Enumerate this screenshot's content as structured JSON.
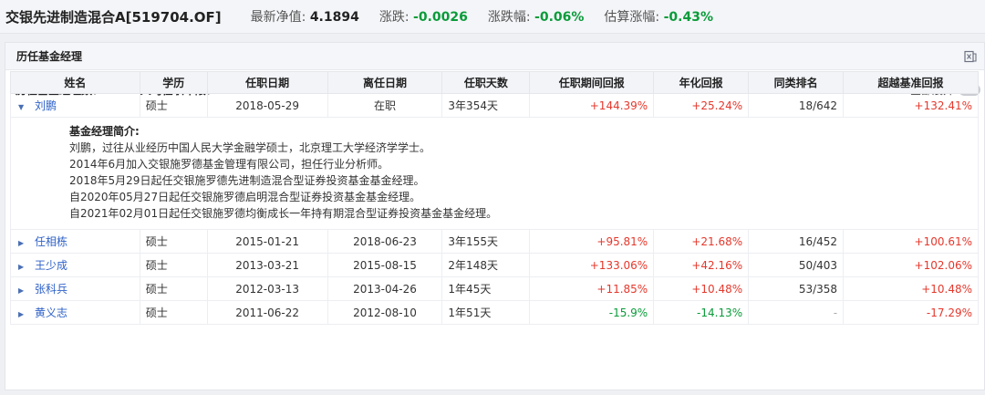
{
  "header": {
    "fund_name": "交银先进制造混合A[519704.OF]",
    "nav_label": "最新净值: ",
    "nav_value": "4.1894",
    "change_label": "涨跌: ",
    "change_value": "-0.0026",
    "change_pct_label": "涨跌幅: ",
    "change_pct_value": "-0.06%",
    "est_label": "估算涨幅: ",
    "est_value": "-0.43%"
  },
  "panel": {
    "title": "历任基金经理",
    "export_icon": "export-excel-icon",
    "count_label": "历任基金经理数：",
    "count_value": "5",
    "avg_label": "人均任职年限：",
    "avg_value": "2.41",
    "expand_all_label": "全部展开"
  },
  "table": {
    "columns": [
      "姓名",
      "学历",
      "任职日期",
      "离任日期",
      "任职天数",
      "任职期间回报",
      "年化回报",
      "同类排名",
      "超越基准回报"
    ],
    "rows": [
      {
        "name": "刘鹏",
        "edu": "硕士",
        "start": "2018-05-29",
        "end": "在职",
        "days": "3年354天",
        "ret": "+144.39%",
        "ann": "+25.24%",
        "rank": "18/642",
        "excess": "+132.41%"
      },
      {
        "name": "任相栋",
        "edu": "硕士",
        "start": "2015-01-21",
        "end": "2018-06-23",
        "days": "3年155天",
        "ret": "+95.81%",
        "ann": "+21.68%",
        "rank": "16/452",
        "excess": "+100.61%"
      },
      {
        "name": "王少成",
        "edu": "硕士",
        "start": "2013-03-21",
        "end": "2015-08-15",
        "days": "2年148天",
        "ret": "+133.06%",
        "ann": "+42.16%",
        "rank": "50/403",
        "excess": "+102.06%"
      },
      {
        "name": "张科兵",
        "edu": "硕士",
        "start": "2012-03-13",
        "end": "2013-04-26",
        "days": "1年45天",
        "ret": "+11.85%",
        "ann": "+10.48%",
        "rank": "53/358",
        "excess": "+10.48%"
      },
      {
        "name": "黄义志",
        "edu": "硕士",
        "start": "2011-06-22",
        "end": "2012-08-10",
        "days": "1年51天",
        "ret": "-15.9%",
        "ann": "-14.13%",
        "rank": "-",
        "excess": "-17.29%"
      }
    ],
    "bio": {
      "title": "基金经理简介:",
      "lines": [
        "刘鹏，过往从业经历中国人民大学金融学硕士，北京理工大学经济学学士。",
        "2014年6月加入交银施罗德基金管理有限公司，担任行业分析师。",
        "2018年5月29日起任交银施罗德先进制造混合型证券投资基金基金经理。",
        "自2020年05月27日起任交银施罗德启明混合型证券投资基金基金经理。",
        "自2021年02月01日起任交银施罗德均衡成长一年持有期混合型证券投资基金基金经理。"
      ]
    }
  },
  "colors": {
    "positive": "#e5382c",
    "negative": "#0a9b3a",
    "link": "#2f62c7"
  }
}
